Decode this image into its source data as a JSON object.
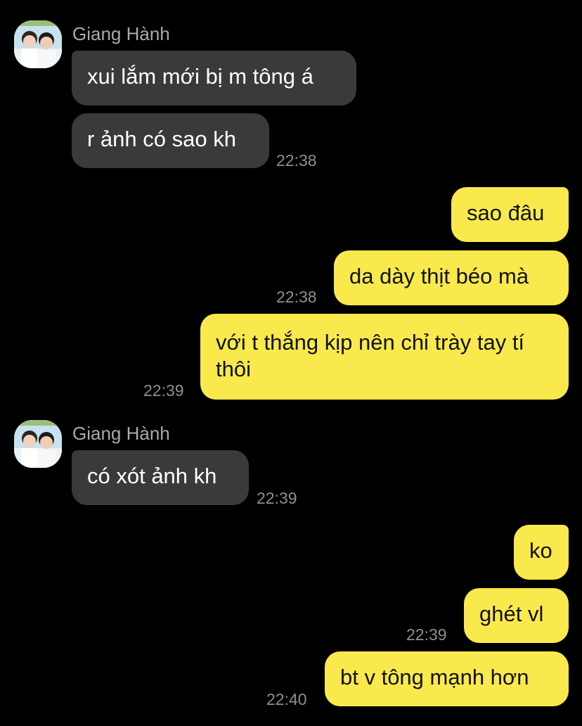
{
  "contact": {
    "name": "Giang Hành"
  },
  "messages": [
    {
      "text": "xui lắm mới bị m tông á"
    },
    {
      "text": "r ảnh có sao kh",
      "time": "22:38"
    },
    {
      "text": "sao đâu"
    },
    {
      "text": "da dày thịt béo mà",
      "time": "22:38"
    },
    {
      "text": "với t thắng kịp nên chỉ trày tay tí thôi",
      "time": "22:39"
    },
    {
      "text": "có xót ảnh kh",
      "time": "22:39"
    },
    {
      "text": "ko"
    },
    {
      "text": "ghét vl",
      "time": "22:39"
    },
    {
      "text": "bt v tông mạnh hơn",
      "time": "22:40"
    }
  ],
  "colors": {
    "background": "#000000",
    "incoming_bubble": "#3a3a3c",
    "outgoing_bubble": "#fae94c",
    "timestamp": "#8e8e93"
  },
  "icons": {
    "avatar": "avatar-photo"
  }
}
